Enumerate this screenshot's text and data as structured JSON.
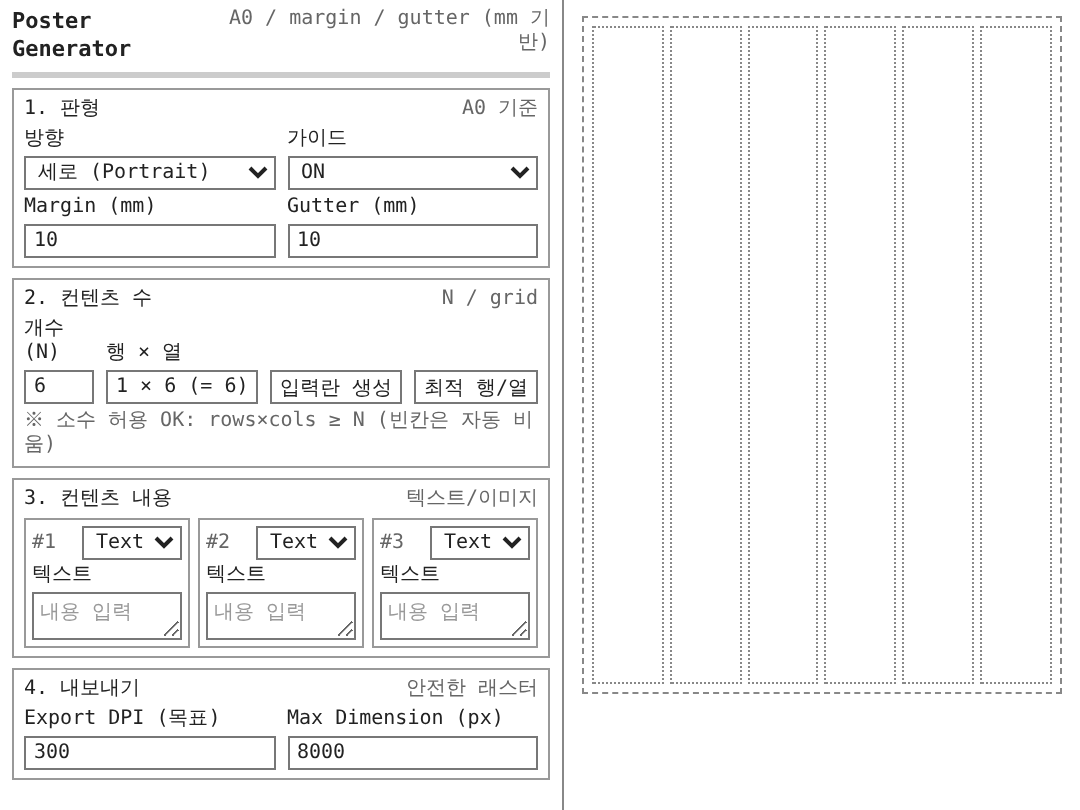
{
  "header": {
    "title": "Poster Generator",
    "subtitle": "A0 / margin / gutter (mm 기반)"
  },
  "format": {
    "title": "1. 판형",
    "note": "A0 기준",
    "fields": [
      {
        "label": "방향",
        "kind": "select",
        "value": "세로 (Portrait)"
      },
      {
        "label": "가이드",
        "kind": "select",
        "value": "ON"
      },
      {
        "label": "Margin (mm)",
        "kind": "input",
        "value": "10"
      },
      {
        "label": "Gutter (mm)",
        "kind": "input",
        "value": "10"
      }
    ]
  },
  "count": {
    "title": "2. 컨텐츠 수",
    "note": "N / grid",
    "fields": [
      {
        "label": "개수 (N)",
        "kind": "input",
        "value": "6"
      },
      {
        "label": "행 × 열",
        "kind": "input",
        "value": "1 × 6 (= 6)"
      }
    ],
    "buttons": [
      "입력란 생성",
      "최적 행/열"
    ],
    "hint": "※ 소수 허용 OK: rows×cols ≥ N (빈칸은 자동 비움)"
  },
  "content": {
    "title": "3. 컨텐츠 내용",
    "note": "텍스트/이미지",
    "items": [
      {
        "number": "#1",
        "type": "Text",
        "label": "텍스트",
        "placeholder": "내용 입력"
      },
      {
        "number": "#2",
        "type": "Text",
        "label": "텍스트",
        "placeholder": "내용 입력"
      },
      {
        "number": "#3",
        "type": "Text",
        "label": "텍스트",
        "placeholder": "내용 입력"
      }
    ]
  },
  "export": {
    "title": "4. 내보내기",
    "note": "안전한 래스터",
    "fields": [
      {
        "label": "Export DPI (목표)",
        "kind": "input",
        "value": "300"
      },
      {
        "label": "Max Dimension (px)",
        "kind": "input",
        "value": "8000"
      }
    ]
  },
  "preview": {
    "guides": true
  }
}
